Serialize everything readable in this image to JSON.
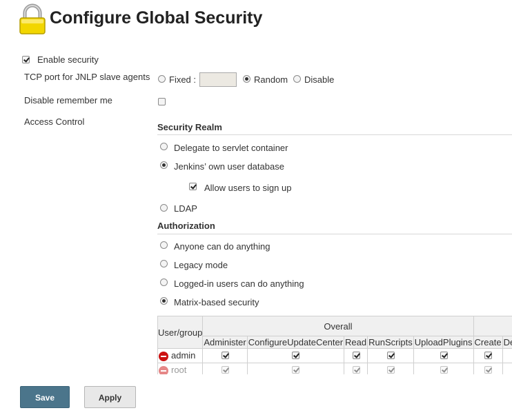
{
  "page": {
    "title": "Configure Global Security"
  },
  "enable_security": {
    "label": "Enable security",
    "checked": true
  },
  "tcp_port": {
    "label": "TCP port for JNLP slave agents",
    "options": [
      "Fixed :",
      "Random",
      "Disable"
    ],
    "selected": "Random",
    "fixed_value": ""
  },
  "remember_me": {
    "label": "Disable remember me",
    "checked": false
  },
  "access_control": {
    "label": "Access Control"
  },
  "security_realm": {
    "heading": "Security Realm",
    "options": [
      "Delegate to servlet container",
      "Jenkins’ own user database",
      "LDAP"
    ],
    "selected": "Jenkins’ own user database",
    "allow_signup": {
      "label": "Allow users to sign up",
      "checked": true
    }
  },
  "authorization": {
    "heading": "Authorization",
    "options": [
      "Anyone can do anything",
      "Legacy mode",
      "Logged-in users can do anything",
      "Matrix-based security"
    ],
    "selected": "Matrix-based security"
  },
  "matrix": {
    "user_group_header": "User/group",
    "group_header": "Overall",
    "columns": [
      "Administer",
      "ConfigureUpdateCenter",
      "Read",
      "RunScripts",
      "UploadPlugins",
      "Create",
      "Delete"
    ],
    "rows": [
      {
        "name": "admin",
        "values": [
          true,
          true,
          true,
          true,
          true,
          true,
          true
        ]
      },
      {
        "name": "root",
        "values": [
          true,
          true,
          true,
          true,
          true,
          true,
          true
        ]
      }
    ]
  },
  "buttons": {
    "save": "Save",
    "apply": "Apply"
  },
  "colors": {
    "save_button": "#4b758b",
    "apply_button": "#e8e8e8",
    "delete_icon": "#cc1111"
  }
}
